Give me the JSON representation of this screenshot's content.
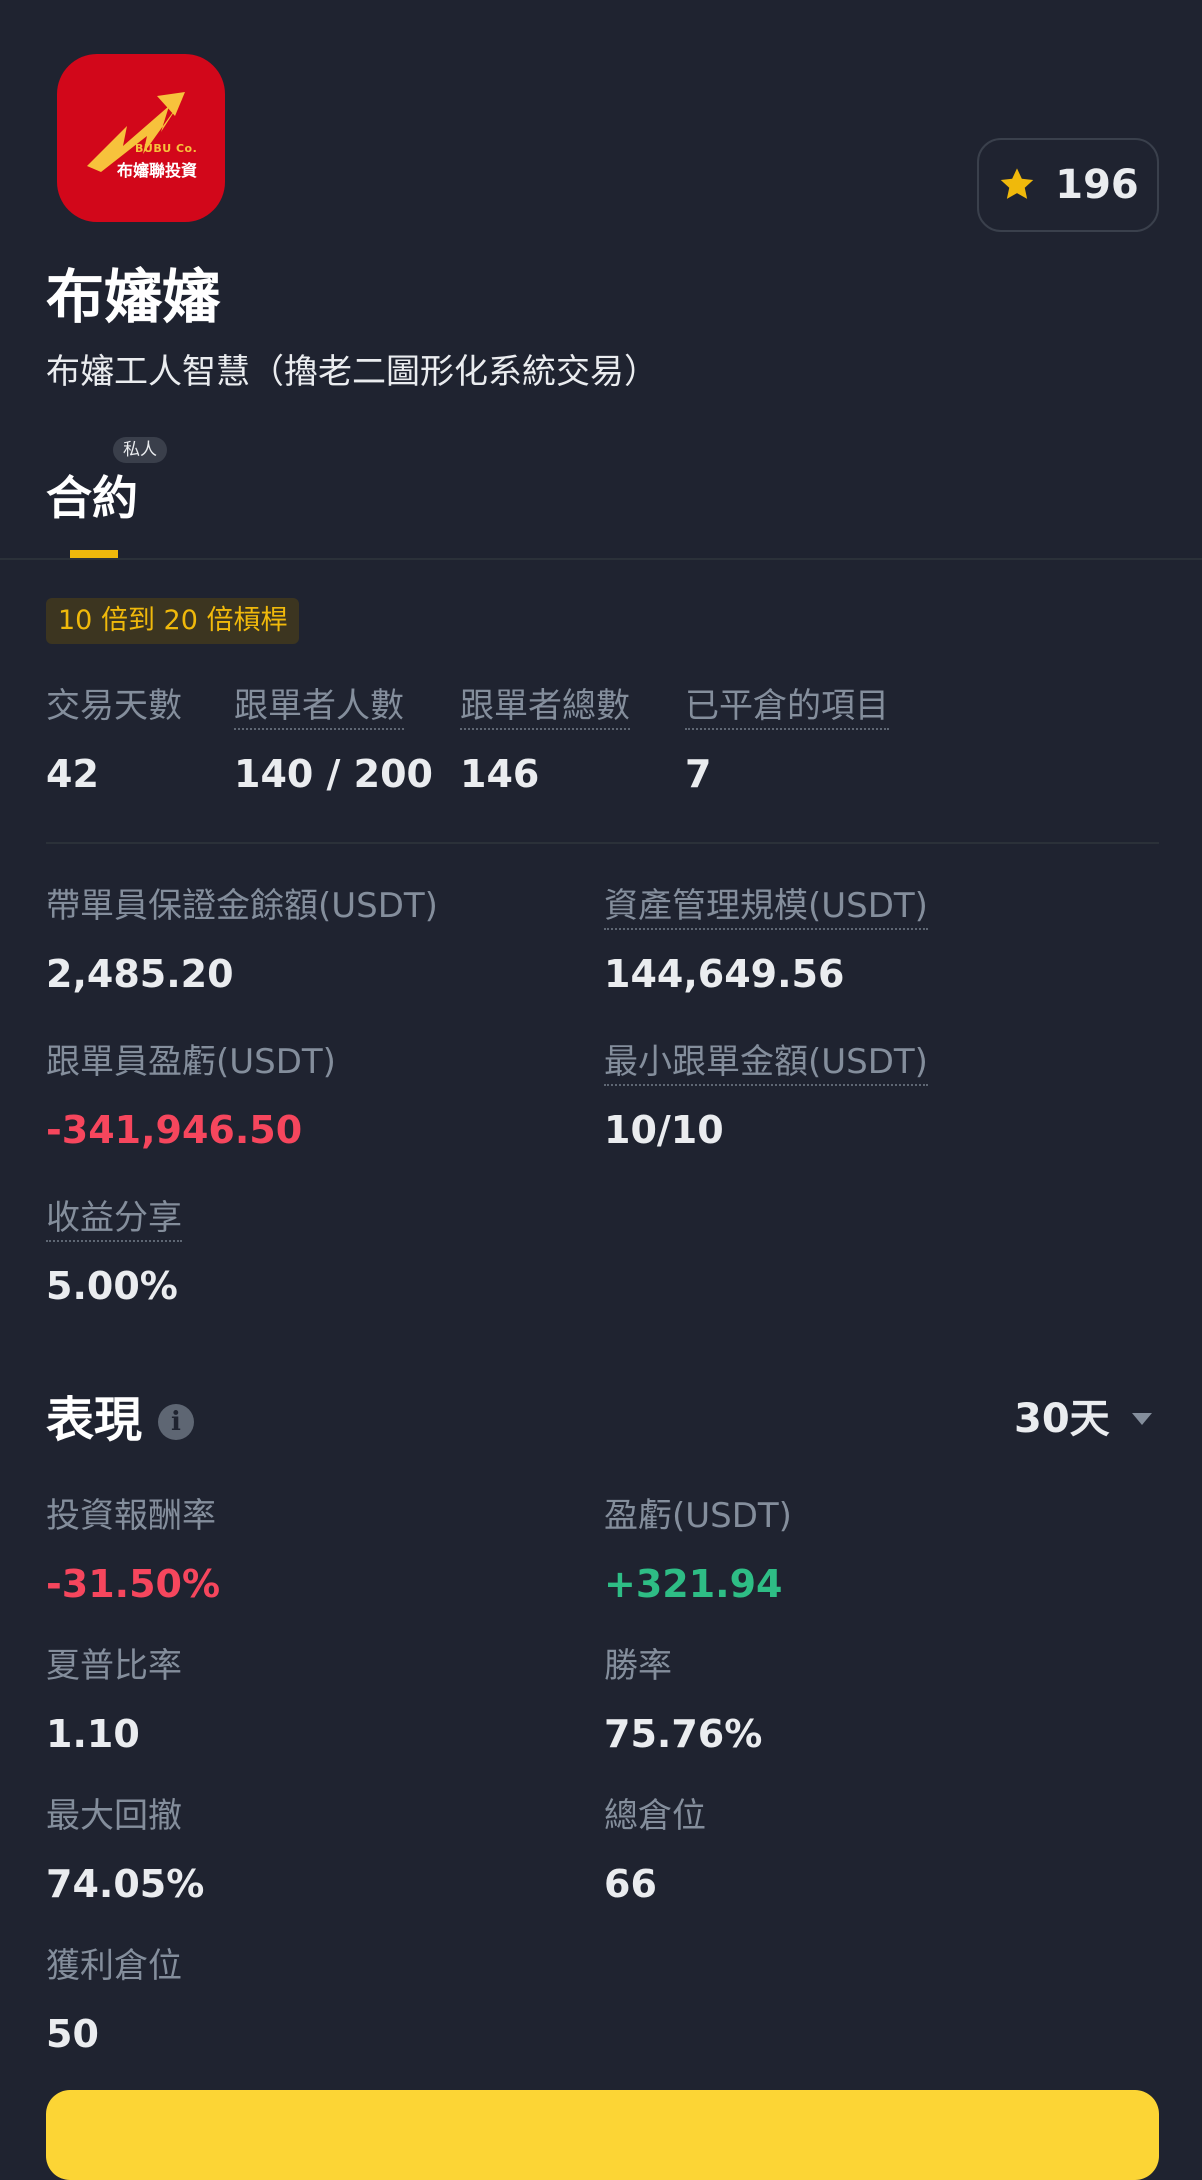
{
  "header": {
    "logo": {
      "company": "BUBU Co.",
      "name": "布嬸聯投資",
      "color": "#d2071a"
    },
    "favorite": {
      "icon": "star-icon",
      "count": "196"
    },
    "title": "布嬸嬸",
    "subtitle": "布嬸工人智慧（擼老二圖形化系統交易）"
  },
  "tabs": [
    {
      "label": "合約",
      "badge": "私人",
      "active": true
    }
  ],
  "leverage_badge": "10 倍到 20 倍槓桿",
  "stats_row": [
    {
      "label": "交易天數",
      "value": "42"
    },
    {
      "label": "跟單者人數",
      "value": "140 / 200"
    },
    {
      "label": "跟單者總數",
      "value": "146"
    },
    {
      "label": "已平倉的項目",
      "value": "7"
    }
  ],
  "metrics": {
    "margin_balance": {
      "label": "帶單員保證金餘額(USDT)",
      "value": "2,485.20"
    },
    "aum": {
      "label": "資產管理規模(USDT)",
      "value": "144,649.56"
    },
    "follower_pnl": {
      "label": "跟單員盈虧(USDT)",
      "value": "-341,946.50"
    },
    "min_copy": {
      "label": "最小跟單金額(USDT)",
      "value": "10/10"
    },
    "profit_share": {
      "label": "收益分享",
      "value": "5.00%"
    }
  },
  "performance": {
    "title": "表現",
    "info_icon": "info-icon",
    "period": "30天",
    "items": {
      "roi": {
        "label": "投資報酬率",
        "value": "-31.50%"
      },
      "pnl": {
        "label": "盈虧(USDT)",
        "value": "+321.94"
      },
      "sharpe": {
        "label": "夏普比率",
        "value": "1.10"
      },
      "win_rate": {
        "label": "勝率",
        "value": "75.76%"
      },
      "max_drawdown": {
        "label": "最大回撤",
        "value": "74.05%"
      },
      "total_positions": {
        "label": "總倉位",
        "value": "66"
      },
      "winning_positions": {
        "label": "獲利倉位",
        "value": "50"
      }
    }
  },
  "colors": {
    "background": "#1f2330",
    "accent": "#f0b90b",
    "negative": "#f6465d",
    "positive": "#2ebd85",
    "muted": "#848e9c"
  }
}
